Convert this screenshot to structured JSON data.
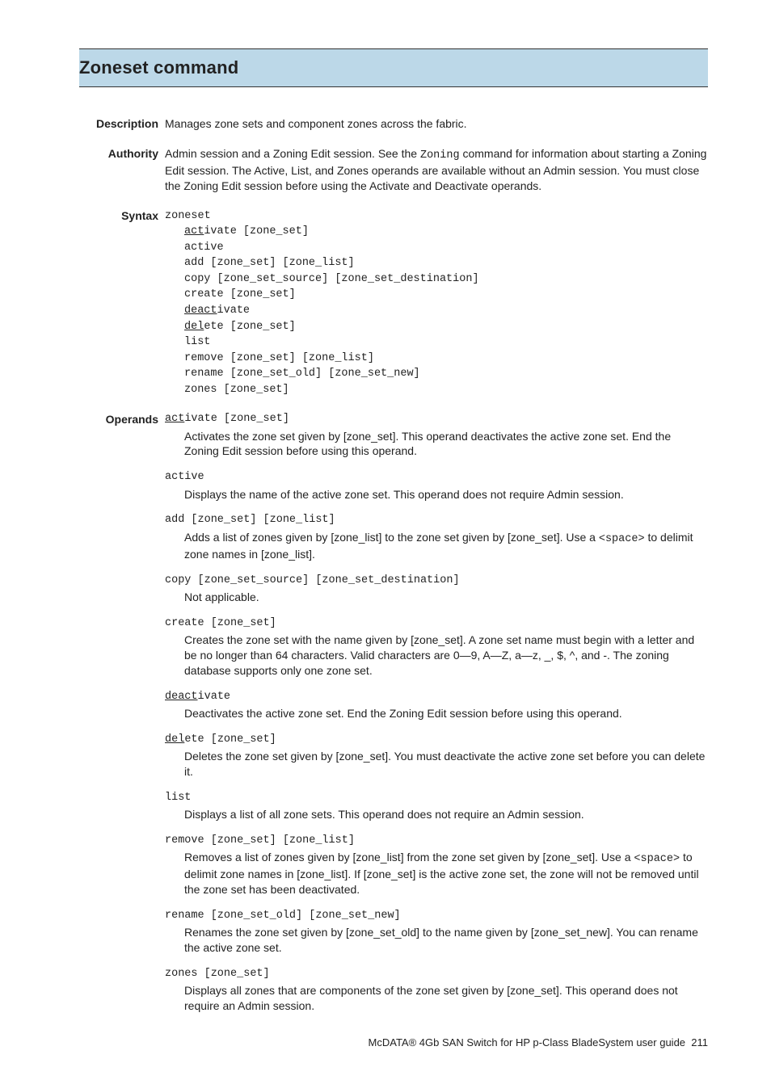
{
  "title": "Zoneset command",
  "sections": {
    "description": {
      "label": "Description",
      "text": "Manages zone sets and component zones across the fabric."
    },
    "authority": {
      "label": "Authority",
      "pre": "Admin session and a Zoning Edit session. See the ",
      "code": "Zoning",
      "post": " command for information about starting a Zoning Edit session. The Active, List, and Zones operands are available without an Admin session. You must close the Zoning Edit session before using the Activate and Deactivate operands."
    },
    "syntax": {
      "label": "Syntax",
      "head": "zoneset",
      "lines": [
        {
          "u": "act",
          "rest": "ivate [zone_set]"
        },
        {
          "u": "",
          "rest": "active"
        },
        {
          "u": "",
          "rest": "add [zone_set] [zone_list]"
        },
        {
          "u": "",
          "rest": "copy [zone_set_source] [zone_set_destination]"
        },
        {
          "u": "",
          "rest": "create [zone_set]"
        },
        {
          "u": "deact",
          "rest": "ivate"
        },
        {
          "u": "del",
          "rest": "ete [zone_set]"
        },
        {
          "u": "",
          "rest": "list"
        },
        {
          "u": "",
          "rest": "remove [zone_set] [zone_list]"
        },
        {
          "u": "",
          "rest": "rename [zone_set_old] [zone_set_new]"
        },
        {
          "u": "",
          "rest": "zones [zone_set]"
        }
      ]
    },
    "operands": {
      "label": "Operands",
      "items": [
        {
          "cmd_u": "act",
          "cmd_rest": "ivate [zone_set]",
          "desc_pre": "Activates the zone set given by [zone_set]. This operand deactivates the active zone set. End the Zoning Edit session before using this operand.",
          "desc_code": "",
          "desc_post": ""
        },
        {
          "cmd_u": "",
          "cmd_rest": "active",
          "desc_pre": "Displays the name of the active zone set. This operand does not require Admin session.",
          "desc_code": "",
          "desc_post": ""
        },
        {
          "cmd_u": "",
          "cmd_rest": "add [zone_set] [zone_list]",
          "desc_pre": "Adds a list of zones given by [zone_list] to the zone set given by [zone_set]. Use a ",
          "desc_code": "<space>",
          "desc_post": " to delimit zone names in [zone_list]."
        },
        {
          "cmd_u": "",
          "cmd_rest": "copy [zone_set_source] [zone_set_destination]",
          "desc_pre": "Not applicable.",
          "desc_code": "",
          "desc_post": ""
        },
        {
          "cmd_u": "",
          "cmd_rest": "create [zone_set]",
          "desc_pre": "Creates the zone set with the name given by [zone_set]. A zone set name must begin with a letter and be no longer than 64 characters. Valid characters are 0—9, A—Z, a—z, _, $, ^, and -. The zoning database supports only one zone set.",
          "desc_code": "",
          "desc_post": ""
        },
        {
          "cmd_u": "deact",
          "cmd_rest": "ivate",
          "desc_pre": "Deactivates the active zone set. End the Zoning Edit session before using this operand.",
          "desc_code": "",
          "desc_post": ""
        },
        {
          "cmd_u": "del",
          "cmd_rest": "ete [zone_set]",
          "desc_pre": "Deletes the zone set given by [zone_set]. You must deactivate the active zone set before you can delete it.",
          "desc_code": "",
          "desc_post": ""
        },
        {
          "cmd_u": "",
          "cmd_rest": "list",
          "desc_pre": "Displays a list of all zone sets. This operand does not require an Admin session.",
          "desc_code": "",
          "desc_post": ""
        },
        {
          "cmd_u": "",
          "cmd_rest": "remove [zone_set] [zone_list]",
          "desc_pre": "Removes a list of zones given by [zone_list] from the zone set given by [zone_set]. Use a ",
          "desc_code": "<space>",
          "desc_post": " to delimit zone names in [zone_list]. If [zone_set] is the active zone set, the zone will not be removed until the zone set has been deactivated."
        },
        {
          "cmd_u": "",
          "cmd_rest": "rename [zone_set_old] [zone_set_new]",
          "desc_pre": "Renames the zone set given by [zone_set_old] to the name given by [zone_set_new]. You can rename the active zone set.",
          "desc_code": "",
          "desc_post": ""
        },
        {
          "cmd_u": "",
          "cmd_rest": "zones [zone_set]",
          "desc_pre": "Displays all zones that are components of the zone set given by [zone_set]. This operand does not require an Admin session.",
          "desc_code": "",
          "desc_post": ""
        }
      ]
    }
  },
  "footer": {
    "text": "McDATA® 4Gb SAN Switch for HP p-Class BladeSystem user guide",
    "page": "211"
  }
}
